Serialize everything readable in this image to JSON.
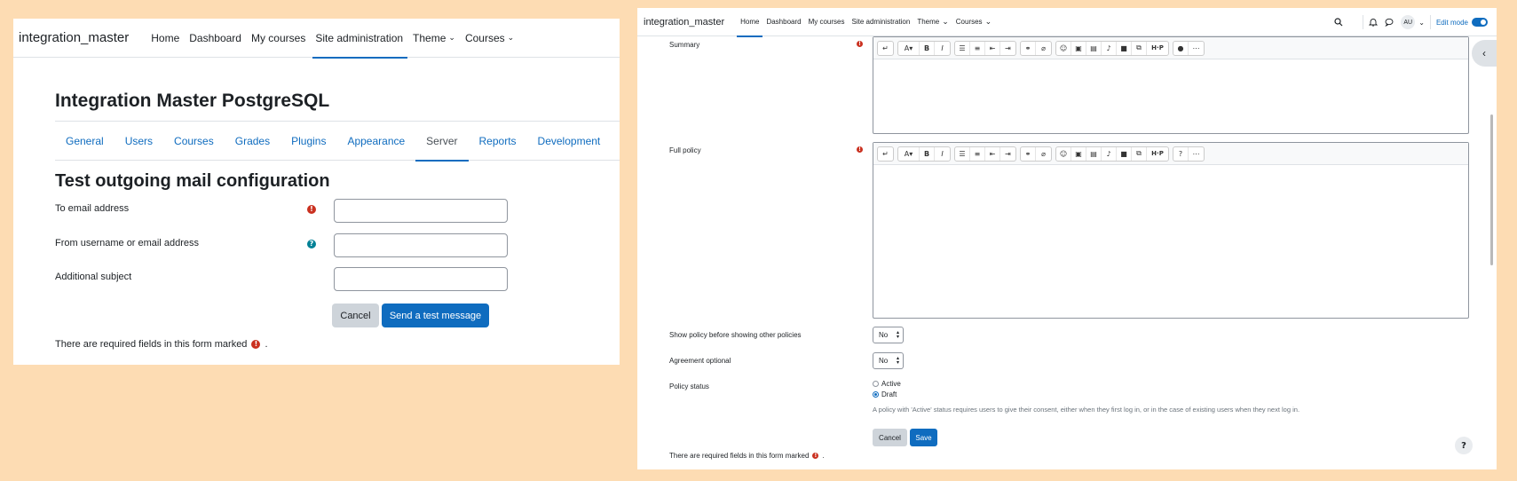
{
  "left": {
    "nav": {
      "brand": "integration_master",
      "items": [
        "Home",
        "Dashboard",
        "My courses",
        "Site administration",
        "Theme",
        "Courses"
      ]
    },
    "heading": "Integration Master PostgreSQL",
    "tabs": [
      "General",
      "Users",
      "Courses",
      "Grades",
      "Plugins",
      "Appearance",
      "Server",
      "Reports",
      "Development"
    ],
    "active_tab": "Server",
    "form": {
      "title": "Test outgoing mail configuration",
      "fields": [
        {
          "label": "To email address",
          "value": "",
          "icon": "required-icon"
        },
        {
          "label": "From username or email address",
          "value": "",
          "icon": "help-icon"
        },
        {
          "label": "Additional subject",
          "value": "",
          "icon": ""
        }
      ],
      "cancel": "Cancel",
      "submit": "Send a test message",
      "required_note": "There are required fields in this form marked",
      "required_note_end": "."
    }
  },
  "right": {
    "nav": {
      "brand": "integration_master",
      "items": [
        "Home",
        "Dashboard",
        "My courses",
        "Site administration",
        "Theme",
        "Courses"
      ],
      "avatar": "AU",
      "edit_mode": "Edit mode"
    },
    "form": {
      "summary_label": "Summary",
      "full_policy_label": "Full policy",
      "show_policy_label": "Show policy before showing other policies",
      "show_policy_value": "No",
      "agreement_label": "Agreement optional",
      "agreement_value": "No",
      "status_label": "Policy status",
      "status_options": [
        "Active",
        "Draft"
      ],
      "status_selected": "Draft",
      "status_note": "A policy with 'Active' status requires users to give their consent, either when they first log in, or in the case of existing users when they next log in.",
      "cancel": "Cancel",
      "save": "Save",
      "required_note": "There are required fields in this form marked",
      "required_note_end": "."
    },
    "toolbar_icons": [
      "undo-icon",
      "font-icon",
      "bold-icon",
      "italic-icon",
      "bullet-list-icon",
      "numbered-list-icon",
      "outdent-icon",
      "indent-icon",
      "link-icon",
      "unlink-icon",
      "emoji-icon",
      "image-icon",
      "media-icon",
      "record-audio-icon",
      "record-video-icon",
      "manage-files-icon",
      "h5p-icon",
      "accessibility-icon",
      "expand-toolbar-icon"
    ]
  },
  "colors": {
    "background": "#fddcb3",
    "primary": "#0f6cbf",
    "required": "#ca3120",
    "help": "#008196"
  }
}
